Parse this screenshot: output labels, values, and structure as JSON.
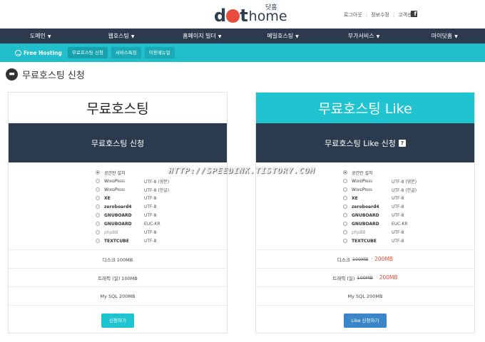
{
  "logo": {
    "dot": "d",
    "t": "t",
    "home": "home",
    "ko": "닷홈"
  },
  "header": {
    "util_links": [
      "로그아웃",
      "정보수정",
      "고객센터"
    ],
    "fb_glyph": "f"
  },
  "mainnav": [
    "도메인",
    "웹호스팅",
    "홈페이지 빌더",
    "메일호스팅",
    "부가서비스",
    "마이닷홈"
  ],
  "subnav": {
    "brand": "Free Hosting",
    "tabs": [
      "무료호스팅 신청",
      "서비스특징",
      "이용매뉴얼"
    ]
  },
  "page": {
    "title": "무료호스팅 신청",
    "title_icon": "circle-icon"
  },
  "cards": [
    {
      "title": "무료호스팅",
      "subtitle": "무료호스팅 신청",
      "options": [
        {
          "name": "공간만 설치",
          "enc": "",
          "selected": true
        },
        {
          "name": "WordPress",
          "enc": "UTF-8 (영문)",
          "selected": false
        },
        {
          "name": "WordPress",
          "enc": "UTF-8 (한글)",
          "selected": false
        },
        {
          "name": "XE",
          "enc": "UTF-8",
          "selected": false
        },
        {
          "name": "zeroboard4",
          "enc": "UTF-8",
          "selected": false
        },
        {
          "name": "GNUBOARD",
          "enc": "UTF-8",
          "selected": false
        },
        {
          "name": "GNUBOARD",
          "enc": "EUC-KR",
          "selected": false
        },
        {
          "name": "phpBB",
          "enc": "UTF-8",
          "selected": false
        },
        {
          "name": "TEXTCUBE",
          "enc": "UTF-8",
          "selected": false
        }
      ],
      "specs": [
        {
          "label": "디스크 100MB"
        },
        {
          "label": "트래픽 (일) 100MB"
        },
        {
          "label": "My SQL 200MB"
        }
      ],
      "button": "신청하기"
    },
    {
      "title": "무료호스팅 Like",
      "subtitle": "무료호스팅 Like 신청",
      "help": "?",
      "options": [
        {
          "name": "공간만 설치",
          "enc": "",
          "selected": true
        },
        {
          "name": "WordPress",
          "enc": "UTF-8 (영문)",
          "selected": false
        },
        {
          "name": "WordPress",
          "enc": "UTF-8 (한글)",
          "selected": false
        },
        {
          "name": "XE",
          "enc": "UTF-8",
          "selected": false
        },
        {
          "name": "zeroboard4",
          "enc": "UTF-8",
          "selected": false
        },
        {
          "name": "GNUBOARD",
          "enc": "UTF-8",
          "selected": false
        },
        {
          "name": "GNUBOARD",
          "enc": "EUC-KR",
          "selected": false
        },
        {
          "name": "phpBB",
          "enc": "UTF-8",
          "selected": false
        },
        {
          "name": "TEXTCUBE",
          "enc": "UTF-8",
          "selected": false
        }
      ],
      "specs": [
        {
          "label": "디스크",
          "old": "100MB",
          "new": "· 200MB"
        },
        {
          "label": "트래픽 (일)",
          "old": "100MB",
          "new": "· 200MB"
        },
        {
          "label": "My SQL 200MB"
        }
      ],
      "button": "Like 신청하기"
    }
  ],
  "watermark": "HTTP://SPEEDINK.TISTORY.COM",
  "colors": {
    "nav": "#2b3a4c",
    "teal": "#20bfcb",
    "accent_red": "#e74c3c",
    "btn_blue": "#3a86c8"
  }
}
